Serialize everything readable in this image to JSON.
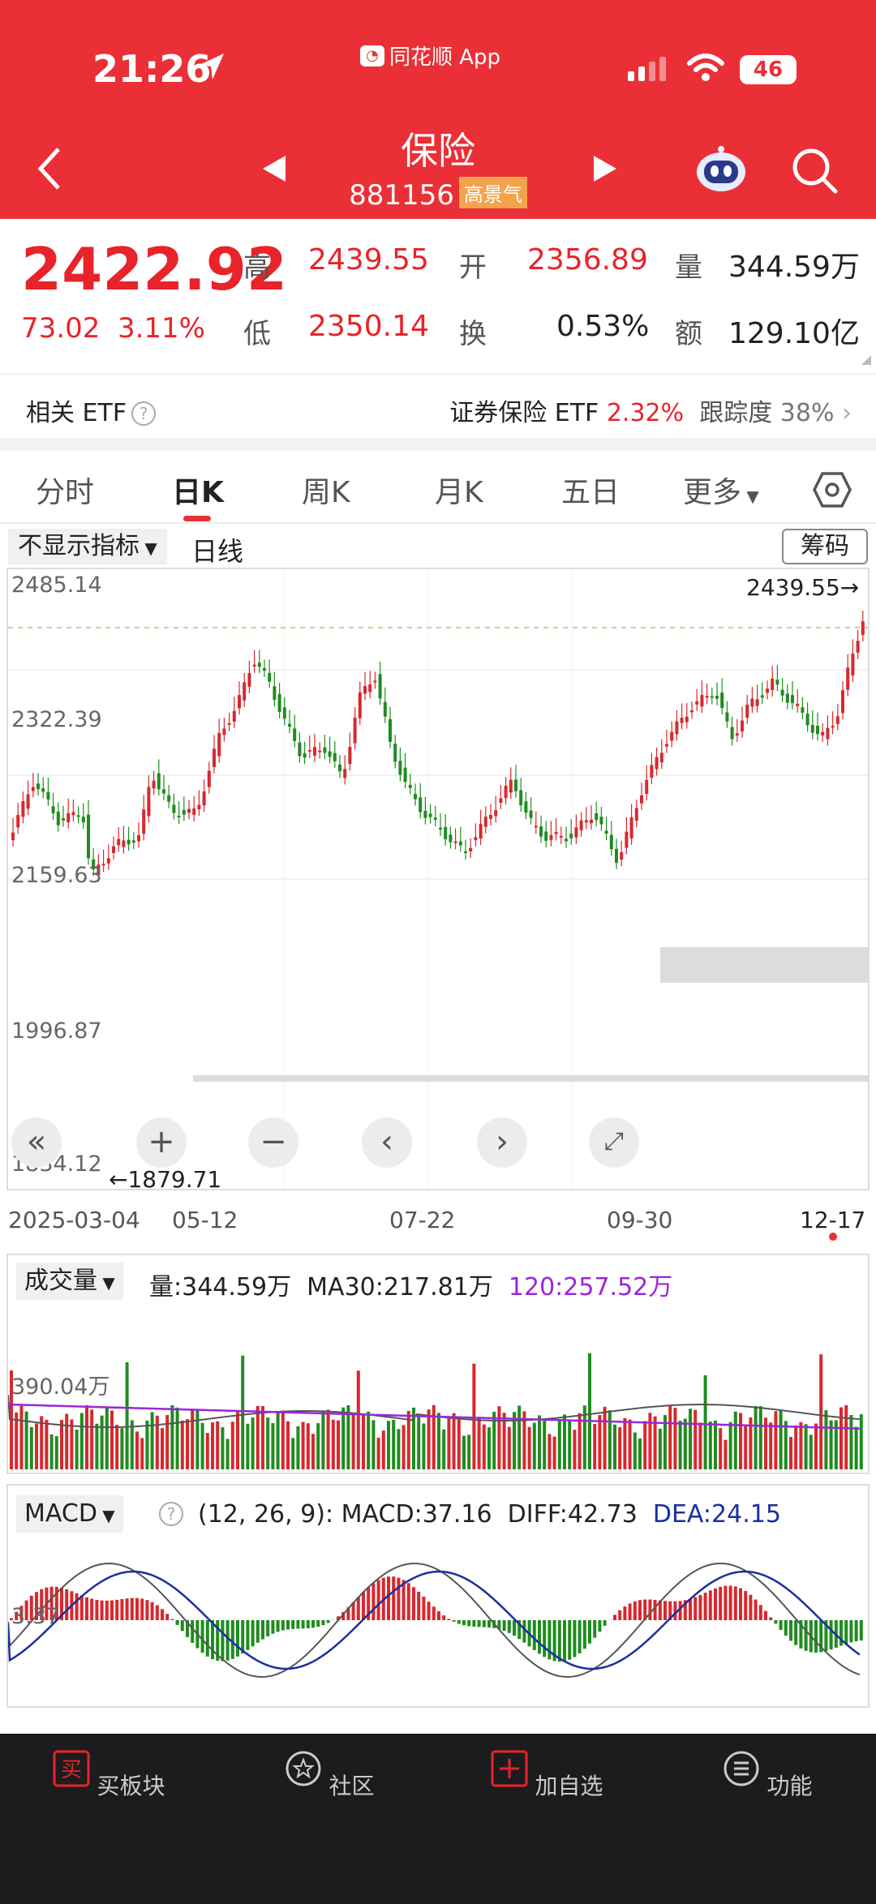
{
  "status": {
    "time": "21:26",
    "app": "同花顺 App",
    "battery": "46"
  },
  "header": {
    "title": "保险",
    "code": "881156",
    "badge": "高景气"
  },
  "quote": {
    "price": "2422.92",
    "change": "73.02",
    "change_pct": "3.11%",
    "high_label": "高",
    "high": "2439.55",
    "low_label": "低",
    "low": "2350.14",
    "open_label": "开",
    "open": "2356.89",
    "turnover_label": "换",
    "turnover": "0.53%",
    "volume_label": "量",
    "volume": "344.59万",
    "amount_label": "额",
    "amount": "129.10亿"
  },
  "etf": {
    "label": "相关 ETF",
    "name": "证券保险 ETF",
    "pct": "2.32%",
    "track_label": "跟踪度",
    "track": "38%"
  },
  "tabs": [
    "分时",
    "日K",
    "周K",
    "月K",
    "五日",
    "更多"
  ],
  "active_tab": "日K",
  "kline": {
    "indicator_label": "不显示指标",
    "period": "日线",
    "chip_label": "筹码",
    "max_label": "2439.55→",
    "min_label": "←1879.71",
    "y_ticks": [
      "2485.14",
      "2322.39",
      "2159.63",
      "1996.87",
      "1834.12"
    ],
    "x_ticks": [
      "2025-03-04",
      "05-12",
      "07-22",
      "09-30",
      "12-17"
    ]
  },
  "volume_panel": {
    "label": "成交量",
    "vol": "量:344.59万",
    "ma30": "MA30:217.81万",
    "ma120": "120:257.52万",
    "y_tick": "390.04万"
  },
  "macd_panel": {
    "label": "MACD",
    "params": "(12, 26, 9):",
    "macd": "MACD:37.16",
    "diff": "DIFF:42.73",
    "dea": "DEA:24.15",
    "y_tick": "3.37"
  },
  "bottom_nav": [
    {
      "label": "买板块",
      "icon": "buy-sector-icon"
    },
    {
      "label": "社区",
      "icon": "community-icon"
    },
    {
      "label": "加自选",
      "icon": "add-watchlist-icon"
    },
    {
      "label": "功能",
      "icon": "menu-icon"
    }
  ],
  "colors": {
    "red": "#ea3036",
    "up": "#d8282e",
    "down": "#1f8c1f",
    "ma_purple": "#9b26d9",
    "dea_blue": "#1a2fa0"
  }
}
